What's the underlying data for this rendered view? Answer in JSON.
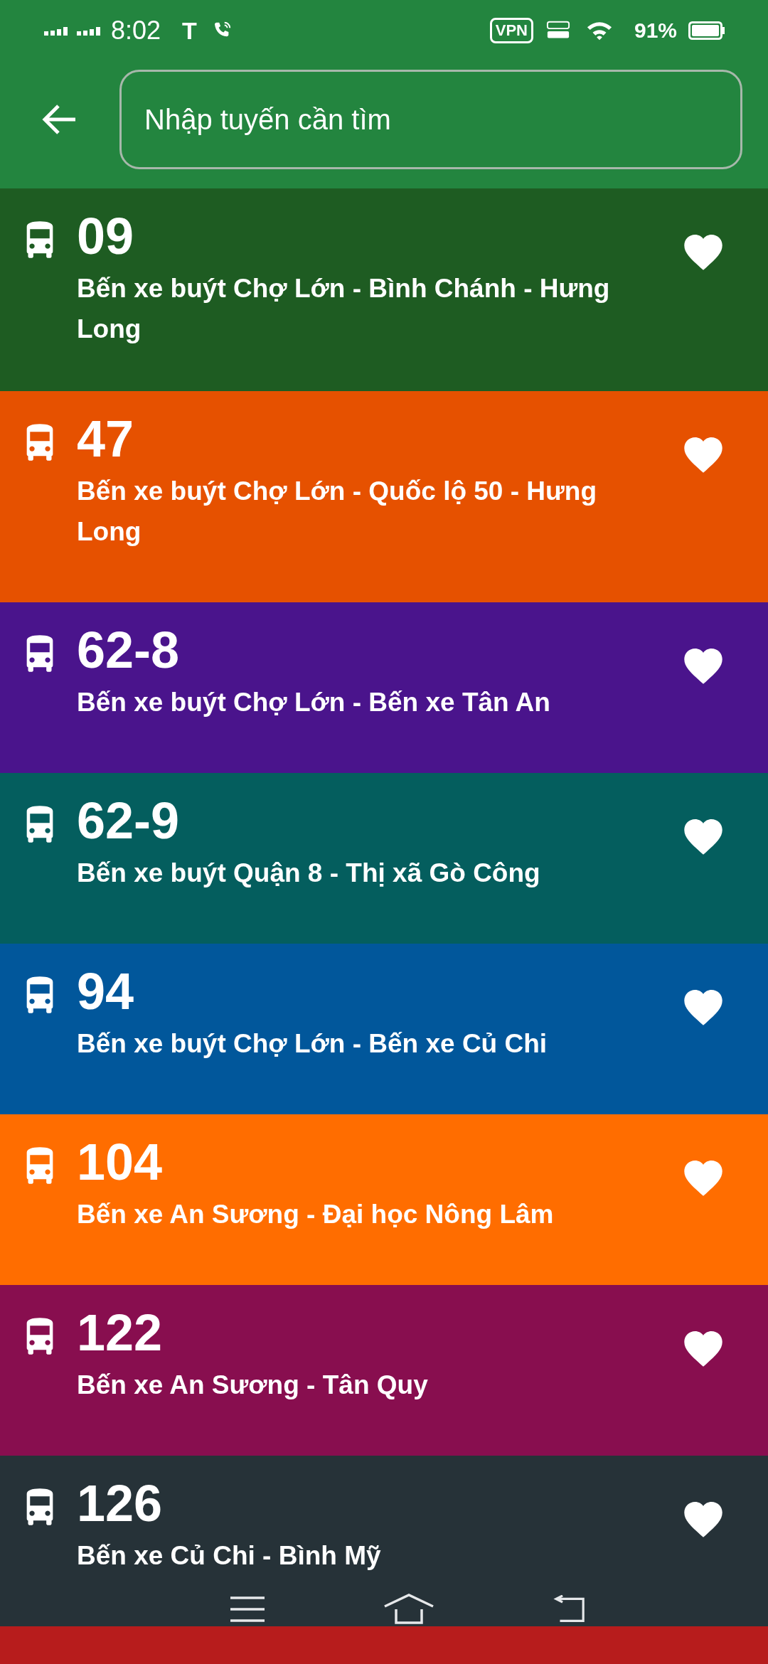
{
  "status_bar": {
    "time": "8:02",
    "carrier": "T",
    "vpn": "VPN",
    "battery": "91%"
  },
  "search": {
    "placeholder": "Nhập tuyến cần tìm"
  },
  "routes": [
    {
      "number": "09",
      "name": "Bến xe buýt Chợ Lớn - Bình Chánh - Hưng Long",
      "color": "#1e5c22"
    },
    {
      "number": "47",
      "name": "Bến xe buýt Chợ Lớn - Quốc lộ 50 - Hưng Long",
      "color": "#e65100"
    },
    {
      "number": "62-8",
      "name": "Bến xe buýt Chợ Lớn - Bến xe Tân An",
      "color": "#4a148c"
    },
    {
      "number": "62-9",
      "name": "Bến xe buýt Quận 8 - Thị xã Gò Công",
      "color": "#045e5e"
    },
    {
      "number": "94",
      "name": "Bến xe buýt Chợ Lớn - Bến xe Củ Chi",
      "color": "#01579b"
    },
    {
      "number": "104",
      "name": "Bến xe An Sương - Đại học Nông Lâm",
      "color": "#ff6d00"
    },
    {
      "number": "122",
      "name": "Bến xe An Sương - Tân Quy",
      "color": "#880e4f"
    },
    {
      "number": "126",
      "name": "Bến xe Củ Chi - Bình Mỹ",
      "color": "#263238"
    },
    {
      "kind": "cut",
      "color": "#b71c1c"
    }
  ]
}
